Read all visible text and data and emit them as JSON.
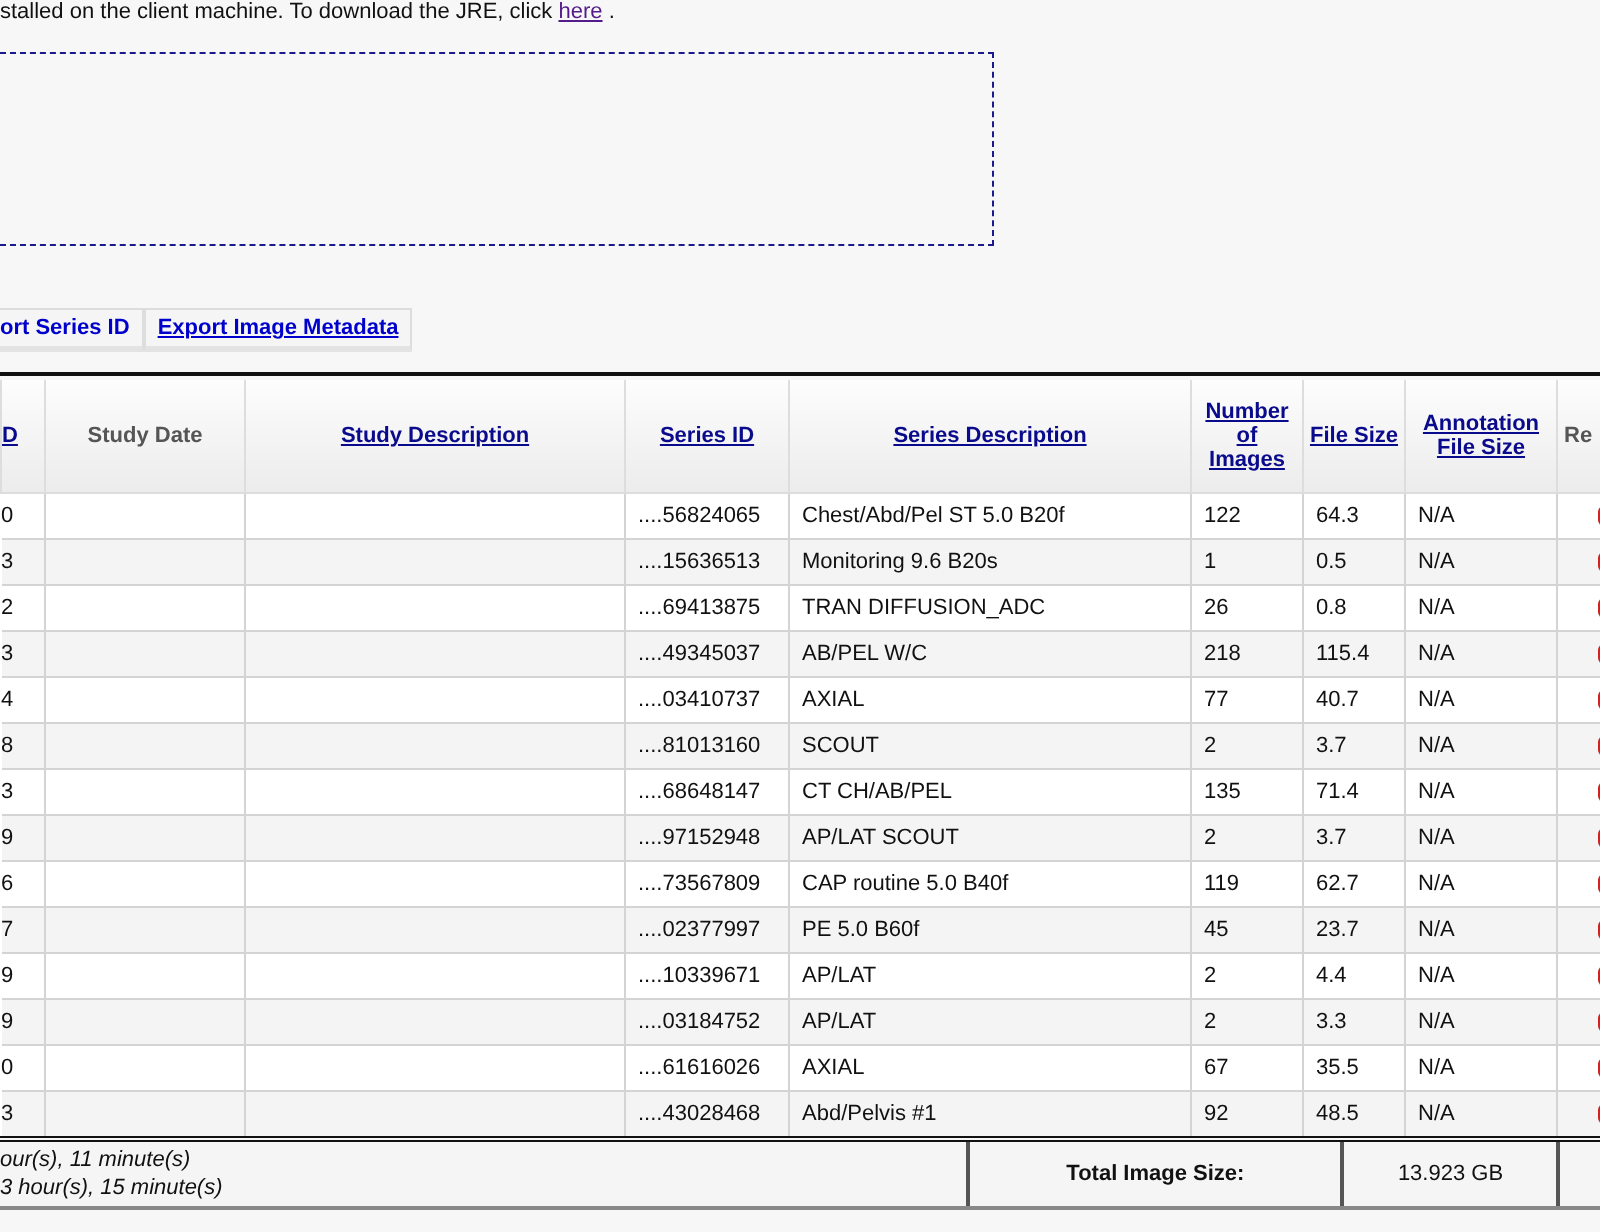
{
  "notice": {
    "text": "stalled on the client machine. To download the JRE, click",
    "link": "here",
    "tail": "."
  },
  "tabs": [
    {
      "label": "ort Series ID",
      "selected": true
    },
    {
      "label": "Export Image Metadata",
      "selected": false
    }
  ],
  "table": {
    "columns": [
      {
        "label": "D",
        "link": true
      },
      {
        "label": "Study Date",
        "link": false
      },
      {
        "label": "Study Description",
        "link": true
      },
      {
        "label": "Series ID",
        "link": true
      },
      {
        "label": "Series Description",
        "link": true
      },
      {
        "label": "Number of Images",
        "link": true
      },
      {
        "label": "File Size",
        "link": true
      },
      {
        "label": "Annotation File Size",
        "link": true
      },
      {
        "label": "Re",
        "link": false
      }
    ],
    "rows": [
      {
        "column_1": "0",
        "series_id": "....56824065",
        "series_description": "Chest/Abd/Pel ST 5.0 B20f",
        "images": "122",
        "file_size": "64.3",
        "annotation_size": "N/A"
      },
      {
        "column_1": "3",
        "series_id": "....15636513",
        "series_description": "Monitoring 9.6 B20s",
        "images": "1",
        "file_size": "0.5",
        "annotation_size": "N/A"
      },
      {
        "column_1": "2",
        "series_id": "....69413875",
        "series_description": "TRAN DIFFUSION_ADC",
        "images": "26",
        "file_size": "0.8",
        "annotation_size": "N/A"
      },
      {
        "column_1": "3",
        "series_id": "....49345037",
        "series_description": "AB/PEL W/C",
        "images": "218",
        "file_size": "115.4",
        "annotation_size": "N/A"
      },
      {
        "column_1": "4",
        "series_id": "....03410737",
        "series_description": "AXIAL",
        "images": "77",
        "file_size": "40.7",
        "annotation_size": "N/A"
      },
      {
        "column_1": "8",
        "series_id": "....81013160",
        "series_description": "SCOUT",
        "images": "2",
        "file_size": "3.7",
        "annotation_size": "N/A"
      },
      {
        "column_1": "3",
        "series_id": "....68648147",
        "series_description": "CT CH/AB/PEL",
        "images": "135",
        "file_size": "71.4",
        "annotation_size": "N/A"
      },
      {
        "column_1": "9",
        "series_id": "....97152948",
        "series_description": "AP/LAT SCOUT",
        "images": "2",
        "file_size": "3.7",
        "annotation_size": "N/A"
      },
      {
        "column_1": "6",
        "series_id": "....73567809",
        "series_description": "CAP routine 5.0 B40f",
        "images": "119",
        "file_size": "62.7",
        "annotation_size": "N/A"
      },
      {
        "column_1": "7",
        "series_id": "....02377997",
        "series_description": "PE 5.0 B60f",
        "images": "45",
        "file_size": "23.7",
        "annotation_size": "N/A"
      },
      {
        "column_1": "9",
        "series_id": "....10339671",
        "series_description": "AP/LAT",
        "images": "2",
        "file_size": "4.4",
        "annotation_size": "N/A"
      },
      {
        "column_1": "9",
        "series_id": "....03184752",
        "series_description": "AP/LAT",
        "images": "2",
        "file_size": "3.3",
        "annotation_size": "N/A"
      },
      {
        "column_1": "0",
        "series_id": "....61616026",
        "series_description": "AXIAL",
        "images": "67",
        "file_size": "35.5",
        "annotation_size": "N/A"
      },
      {
        "column_1": "3",
        "series_id": "....43028468",
        "series_description": "Abd/Pelvis #1",
        "images": "92",
        "file_size": "48.5",
        "annotation_size": "N/A"
      }
    ]
  },
  "footer": {
    "times": [
      "our(s), 11 minute(s)",
      "3 hour(s), 15 minute(s)"
    ],
    "total_label": "Total Image Size:",
    "total_value": "13.923 GB"
  }
}
